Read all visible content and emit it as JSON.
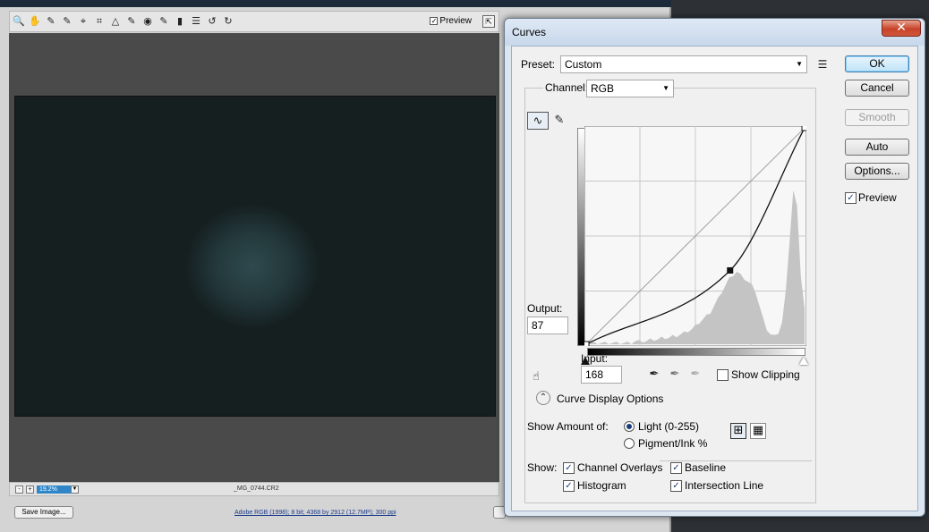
{
  "raw_window": {
    "toolbar_icons": [
      "zoom-icon",
      "hand-icon",
      "white-balance-icon",
      "color-sampler-icon",
      "target-adjust-icon",
      "crop-icon",
      "straighten-icon",
      "spot-removal-icon",
      "red-eye-icon",
      "adjustment-brush-icon",
      "graduated-filter-icon",
      "preferences-icon",
      "rotate-left-icon",
      "rotate-right-icon"
    ],
    "toolbar_glyphs": [
      "🔍",
      "✋",
      "✎",
      "✎",
      "⌖",
      "⌗",
      "△",
      "✎",
      "◉",
      "✎",
      "▮",
      "☰",
      "↺",
      "↻"
    ],
    "preview_label": "Preview",
    "zoom_value": "19.2%",
    "zoom_minus": "-",
    "zoom_plus": "+",
    "filename": "_MG_0744.CR2",
    "save_button_label": "Save Image...",
    "workflow_text": "Adobe RGB (1998); 8 bit; 4368 by 2912 (12.7MP); 300 ppi"
  },
  "curves": {
    "title": "Curves",
    "close_glyph": "✕",
    "preset_label": "Preset:",
    "preset_value": "Custom",
    "channel_label": "Channel:",
    "channel_value": "RGB",
    "buttons": {
      "ok": "OK",
      "cancel": "Cancel",
      "smooth": "Smooth",
      "auto": "Auto",
      "options": "Options..."
    },
    "preview_label": "Preview",
    "preview_checked": true,
    "output_label": "Output:",
    "output_value": "87",
    "input_label": "Input:",
    "input_value": "168",
    "show_clipping_label": "Show Clipping",
    "curve_display_options_label": "Curve Display Options",
    "show_amount_label": "Show Amount of:",
    "light_label": "Light  (0-255)",
    "pigment_label": "Pigment/Ink %",
    "amount_selected": "light",
    "show_label": "Show:",
    "show_options": {
      "channel_overlays": "Channel Overlays",
      "baseline": "Baseline",
      "histogram": "Histogram",
      "intersection_line": "Intersection Line"
    },
    "curve_points": [
      [
        0,
        0
      ],
      [
        168,
        87
      ],
      [
        255,
        255
      ]
    ],
    "accent_color": "#3c7fb1"
  }
}
